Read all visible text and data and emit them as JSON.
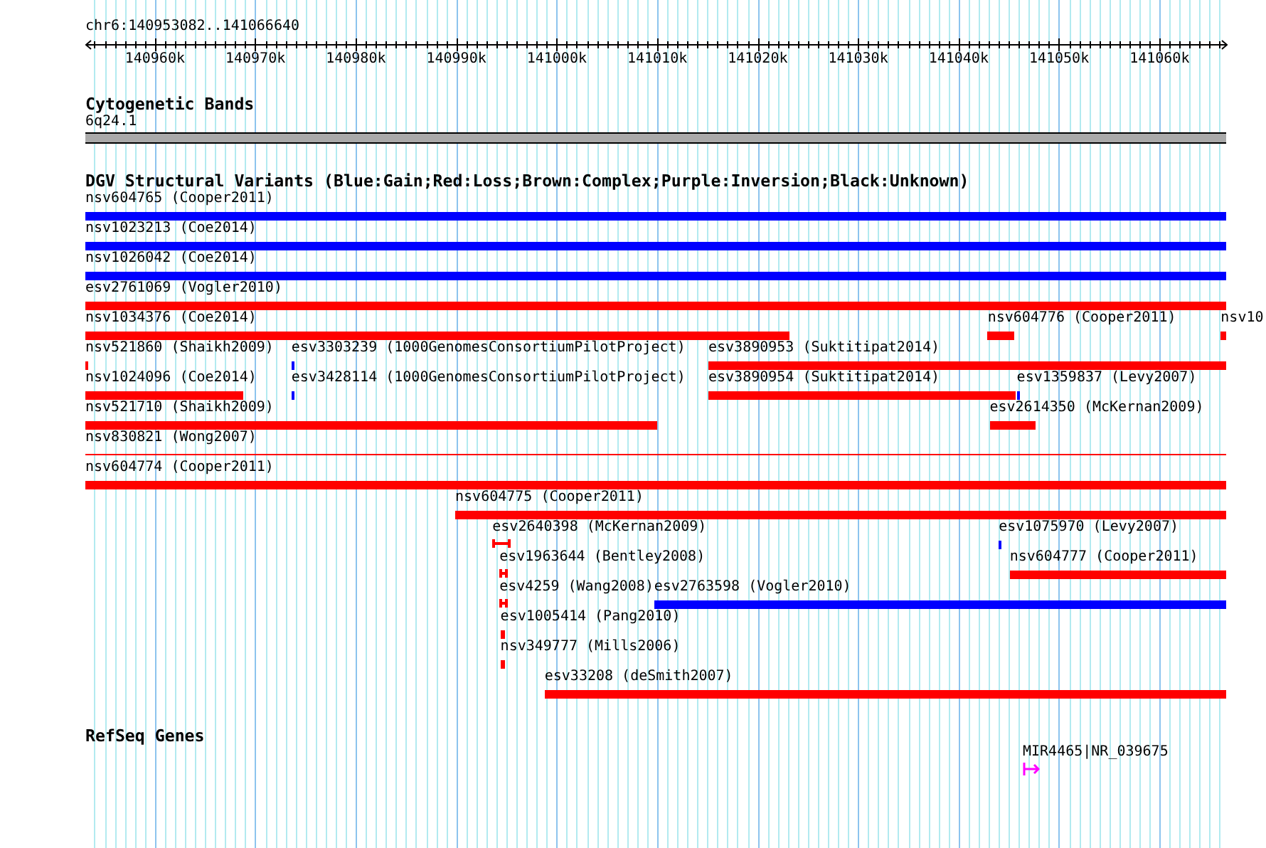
{
  "ruler": {
    "label": "chr6:140953082..141066640",
    "ticks": [
      "140960k",
      "140970k",
      "140980k",
      "140990k",
      "141000k",
      "141010k",
      "141020k",
      "141030k",
      "141040k",
      "141050k",
      "141060k"
    ]
  },
  "tracks": [
    {
      "kind": "bands",
      "title": "Cytogenetic Bands",
      "bands": [
        {
          "label": "6q24.1"
        }
      ]
    },
    {
      "kind": "variants",
      "title": "DGV Structural Variants (Blue:Gain;Red:Loss;Brown:Complex;Purple:Inversion;Black:Unknown)",
      "rows": [
        [
          {
            "label": "nsv604765 (Cooper2011)",
            "kind": "bar",
            "color": "#0000ff"
          }
        ],
        [
          {
            "label": "nsv1023213 (Coe2014)",
            "kind": "bar",
            "color": "#0000ff"
          }
        ],
        [
          {
            "label": "nsv1026042 (Coe2014)",
            "kind": "bar",
            "color": "#0000ff"
          }
        ],
        [
          {
            "label": "esv2761069 (Vogler2010)",
            "kind": "bar",
            "color": "#ff0000"
          }
        ],
        [
          {
            "label": "nsv1034376 (Coe2014)",
            "kind": "bar",
            "color": "#ff0000"
          },
          {
            "label": "nsv604776 (Cooper2011)",
            "kind": "bar",
            "color": "#ff0000"
          },
          {
            "label": "nsv10",
            "kind": "bar",
            "color": "#ff0000"
          }
        ],
        [
          {
            "label": "nsv521860 (Shaikh2009)",
            "kind": "bar",
            "color": "#ff0000"
          },
          {
            "label": "esv3303239 (1000GenomesConsortiumPilotProject)",
            "kind": "bar",
            "color": "#0000ff"
          },
          {
            "label": "esv3890953 (Suktitipat2014)",
            "kind": "bar",
            "color": "#ff0000"
          }
        ],
        [
          {
            "label": "nsv1024096 (Coe2014)",
            "kind": "bar",
            "color": "#ff0000"
          },
          {
            "label": "esv3428114 (1000GenomesConsortiumPilotProject)",
            "kind": "bar",
            "color": "#0000ff"
          },
          {
            "label": "esv3890954 (Suktitipat2014)",
            "kind": "bar",
            "color": "#ff0000"
          },
          {
            "label": "esv1359837 (Levy2007)",
            "kind": "bar",
            "color": "#0000ff"
          }
        ],
        [
          {
            "label": "nsv521710 (Shaikh2009)",
            "kind": "bar",
            "color": "#ff0000"
          },
          {
            "label": "esv2614350 (McKernan2009)",
            "kind": "bar",
            "color": "#ff0000"
          }
        ],
        [
          {
            "label": "nsv830821 (Wong2007)",
            "kind": "line",
            "color": "#ff0000"
          }
        ],
        [
          {
            "label": "nsv604774 (Cooper2011)",
            "kind": "bar",
            "color": "#ff0000"
          }
        ],
        [
          {
            "label": "nsv604775 (Cooper2011)",
            "kind": "bar",
            "color": "#ff0000"
          }
        ],
        [
          {
            "label": "esv2640398 (McKernan2009)",
            "kind": "span",
            "color": "#ff0000"
          },
          {
            "label": "esv1075970 (Levy2007)",
            "kind": "bar",
            "color": "#0000ff"
          }
        ],
        [
          {
            "label": "esv1963644 (Bentley2008)",
            "kind": "span",
            "color": "#ff0000"
          },
          {
            "label": "nsv604777 (Cooper2011)",
            "kind": "bar",
            "color": "#ff0000"
          }
        ],
        [
          {
            "label": "esv4259 (Wang2008)",
            "kind": "span",
            "color": "#ff0000"
          },
          {
            "label": "esv2763598 (Vogler2010)",
            "kind": "bar",
            "color": "#0000ff"
          }
        ],
        [
          {
            "label": "esv1005414 (Pang2010)",
            "kind": "bar",
            "color": "#ff0000"
          }
        ],
        [
          {
            "label": "nsv349777 (Mills2006)",
            "kind": "bar",
            "color": "#ff0000"
          }
        ],
        [
          {
            "label": "esv33208 (deSmith2007)",
            "kind": "bar",
            "color": "#ff0000"
          }
        ]
      ]
    },
    {
      "kind": "genes",
      "title": "RefSeq Genes",
      "genes": [
        {
          "label": "MIR4465|NR_039675"
        }
      ]
    }
  ]
}
